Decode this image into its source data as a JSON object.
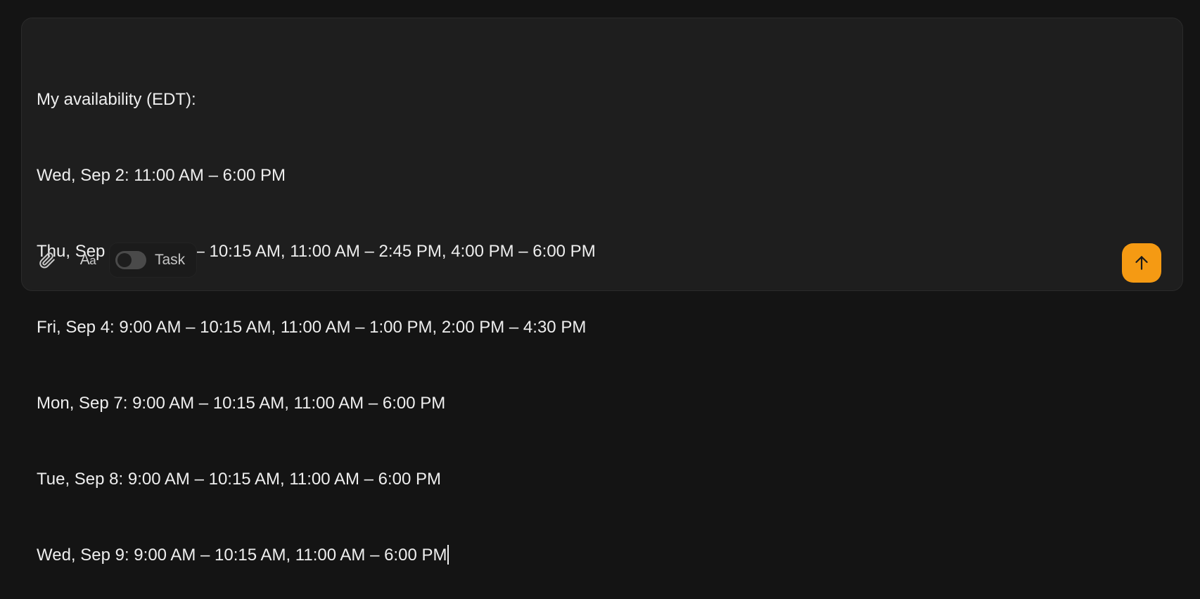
{
  "composer": {
    "lines": [
      "My availability (EDT):",
      "Wed, Sep 2: 11:00 AM – 6:00 PM",
      "Thu, Sep 3: 9:00 AM – 10:15 AM, 11:00 AM – 2:45 PM, 4:00 PM – 6:00 PM",
      "Fri, Sep 4: 9:00 AM – 10:15 AM, 11:00 AM – 1:00 PM, 2:00 PM – 4:30 PM",
      "Mon, Sep 7: 9:00 AM – 10:15 AM, 11:00 AM – 6:00 PM",
      "Tue, Sep 8: 9:00 AM – 10:15 AM, 11:00 AM – 6:00 PM",
      "Wed, Sep 9: 9:00 AM – 10:15 AM, 11:00 AM – 6:00 PM"
    ]
  },
  "toolbar": {
    "attach_icon": "paperclip-icon",
    "format_label_big": "A",
    "format_label_small": "a",
    "task_label": "Task",
    "task_enabled": false
  },
  "send": {
    "icon": "arrow-up-icon",
    "color": "#f59a13"
  }
}
